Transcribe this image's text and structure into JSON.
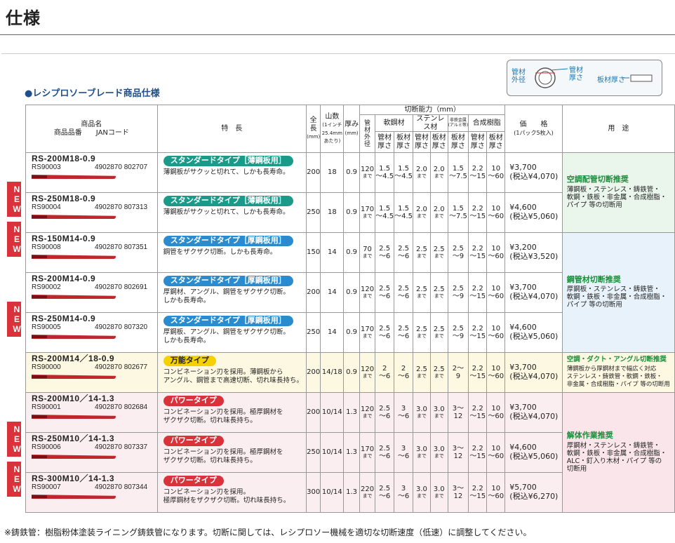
{
  "page": {
    "title": "仕様",
    "section_title": "●レシプロソーブレード商品仕様",
    "footnote": "※鋳鉄管：樹脂粉体塗装ライニング鋳鉄管になります。切断に関しては、レシプロソー機械を適切な切断速度（低速）に調整してください。",
    "new_label": "NEW"
  },
  "legend": {
    "pipe_outer": "管材\n外径",
    "pipe_thickness": "管材\n厚さ",
    "plate_thickness": "板材厚さ"
  },
  "header": {
    "product_name": "商品名",
    "product_code_jan": "商品品番　　JANコード",
    "features": "特　長",
    "length": "全長",
    "length_unit": "(mm)",
    "teeth": "山数",
    "teeth_unit": "(1インチ\n25.4mm\nあたり)",
    "thickness": "厚み",
    "thickness_unit": "(mm)",
    "cutting_capacity": "切断能力（mm）",
    "pipe_outer_dia": "管\n材\n外\n径",
    "mild_steel": "軟鋼材",
    "stainless": "ステンレス材",
    "nonferrous": "非鉄金属\n(アルミ等)",
    "synthetic_resin": "合成樹脂",
    "pipe_thick": "管材\n厚さ",
    "plate_thick": "板材\n厚さ",
    "price": "価　　格",
    "price_note": "(1パック5枚入)",
    "use": "用　途",
    "made_suffix": "まで"
  },
  "products": [
    {
      "model": "RS-200M18-0.9",
      "code": "RS90003",
      "jan": "4902870 802707",
      "badge": "スタンダードタイプ［薄鋼板用］",
      "desc": "薄鋼板がサクッと切れて、しかも長寿命。",
      "length": "200",
      "teeth": "18",
      "thick": "0.9",
      "dia": "120",
      "ms_pipe": "1.5\n～4.5",
      "ms_plate": "1.5\n～4.5",
      "ss_pipe": "2.0",
      "ss_plate": "2.0",
      "nf": "1.5\n～7.5",
      "res_pipe": "2.2\n～15",
      "res_plate": "10\n～60",
      "price": "¥3,700",
      "price_tax": "(税込¥4,070)",
      "new": false
    },
    {
      "model": "RS-250M18-0.9",
      "code": "RS90004",
      "jan": "4902870 807313",
      "badge": "スタンダードタイプ［薄鋼板用］",
      "desc": "薄鋼板がサクッと切れて、しかも長寿命。",
      "length": "250",
      "teeth": "18",
      "thick": "0.9",
      "dia": "170",
      "ms_pipe": "1.5\n～4.5",
      "ms_plate": "1.5\n～4.5",
      "ss_pipe": "2.0",
      "ss_plate": "2.0",
      "nf": "1.5\n～7.5",
      "res_pipe": "2.2\n～15",
      "res_plate": "10\n～60",
      "price": "¥4,600",
      "price_tax": "(税込¥5,060)",
      "new": true
    },
    {
      "model": "RS-150M14-0.9",
      "code": "RS90008",
      "jan": "4902870 807351",
      "badge": "スタンダードタイプ［厚鋼板用］",
      "desc": "鋼管をザクザク切断。しかも長寿命。",
      "length": "150",
      "teeth": "14",
      "thick": "0.9",
      "dia": "70",
      "ms_pipe": "2.5\n～6",
      "ms_plate": "2.5\n～6",
      "ss_pipe": "2.5",
      "ss_plate": "2.5",
      "nf": "2.5\n～9",
      "res_pipe": "2.2\n～15",
      "res_plate": "10\n～60",
      "price": "¥3,200",
      "price_tax": "(税込¥3,520)",
      "new": true
    },
    {
      "model": "RS-200M14-0.9",
      "code": "RS90002",
      "jan": "4902870 802691",
      "badge": "スタンダードタイプ［厚鋼板用］",
      "desc": "厚鋼材、アングル、鋼管をザクザク切断。\nしかも長寿命。",
      "length": "200",
      "teeth": "14",
      "thick": "0.9",
      "dia": "120",
      "ms_pipe": "2.5\n～6",
      "ms_plate": "2.5\n～6",
      "ss_pipe": "2.5",
      "ss_plate": "2.5",
      "nf": "2.5\n～9",
      "res_pipe": "2.2\n～15",
      "res_plate": "10\n～60",
      "price": "¥3,700",
      "price_tax": "(税込¥4,070)",
      "new": false
    },
    {
      "model": "RS-250M14-0.9",
      "code": "RS90005",
      "jan": "4902870 807320",
      "badge": "スタンダードタイプ［厚鋼板用］",
      "desc": "厚鋼板、アングル、鋼管をザクザク切断。\nしかも長寿命。",
      "length": "250",
      "teeth": "14",
      "thick": "0.9",
      "dia": "170",
      "ms_pipe": "2.5\n～6",
      "ms_plate": "2.5\n～6",
      "ss_pipe": "2.5",
      "ss_plate": "2.5",
      "nf": "2.5\n～9",
      "res_pipe": "2.2\n～15",
      "res_plate": "10\n～60",
      "price": "¥4,600",
      "price_tax": "(税込¥5,060)",
      "new": true
    },
    {
      "model": "RS-200M14／18-0.9",
      "code": "RS90000",
      "jan": "4902870 802677",
      "badge": "万能タイプ",
      "desc": "コンビネーション刃を採用。薄鋼板から\nアングル、鋼管まで高速切断、切れ味長持ち。",
      "length": "200",
      "teeth": "14/18",
      "thick": "0.9",
      "dia": "120",
      "ms_pipe": "2\n～6",
      "ms_plate": "2\n～6",
      "ss_pipe": "2.5",
      "ss_plate": "2.5",
      "nf": "2～\n9",
      "res_pipe": "2.2\n～15",
      "res_plate": "10\n～60",
      "price": "¥3,700",
      "price_tax": "(税込¥4,070)",
      "new": false
    },
    {
      "model": "RS-200M10／14-1.3",
      "code": "RS90001",
      "jan": "4902870 802684",
      "badge": "パワータイプ",
      "desc": "コンビネーション刃を採用。極厚鋼材を\nザクザク切断。切れ味長持ち。",
      "length": "200",
      "teeth": "10/14",
      "thick": "1.3",
      "dia": "120",
      "ms_pipe": "2.5\n～6",
      "ms_plate": "3\n～6",
      "ss_pipe": "3.0",
      "ss_plate": "3.0",
      "nf": "3～\n12",
      "res_pipe": "2.2\n～15",
      "res_plate": "10\n～60",
      "price": "¥3,700",
      "price_tax": "(税込¥4,070)",
      "new": false
    },
    {
      "model": "RS-250M10／14-1.3",
      "code": "RS90006",
      "jan": "4902870 807337",
      "badge": "パワータイプ",
      "desc": "コンビネーション刃を採用。極厚鋼材を\nザクザク切断。切れ味長持ち。",
      "length": "250",
      "teeth": "10/14",
      "thick": "1.3",
      "dia": "170",
      "ms_pipe": "2.5\n～6",
      "ms_plate": "3\n～6",
      "ss_pipe": "3.0",
      "ss_plate": "3.0",
      "nf": "3～\n12",
      "res_pipe": "2.2\n～15",
      "res_plate": "10\n～60",
      "price": "¥4,600",
      "price_tax": "(税込¥5,060)",
      "new": true
    },
    {
      "model": "RS-300M10／14-1.3",
      "code": "RS90007",
      "jan": "4902870 807344",
      "badge": "パワータイプ",
      "desc": "コンビネーション刃を採用。\n極厚鋼材をザクザク切断。切れ味長持ち。",
      "length": "300",
      "teeth": "10/14",
      "thick": "1.3",
      "dia": "220",
      "ms_pipe": "2.5\n～6",
      "ms_plate": "3\n～6",
      "ss_pipe": "3.0",
      "ss_plate": "3.0",
      "nf": "3～\n12",
      "res_pipe": "2.2\n～15",
      "res_plate": "10\n～60",
      "price": "¥5,700",
      "price_tax": "(税込¥6,270)",
      "new": true
    }
  ],
  "uses": [
    {
      "title": "空調配管切断推奨",
      "text": "薄鋼板・ステンレス・鋳鉄管・\n軟鋼・鉄板・非金属・合成樹脂・\nパイプ 等の切断用"
    },
    {
      "title": "鋼管材切断推奨",
      "text": "厚鋼板・ステンレス・鋳鉄管・\n軟鋼・鉄板・非金属・合成樹脂・\nパイプ 等の切断用"
    },
    {
      "title": "空調・ダクト・アングル切断推奨",
      "text": "薄鋼板から厚鋼材まで幅広く対応\nステンレス・鋳鉄管・軟鋼・鉄板・\n非金属・合成樹脂・パイプ 等の切断用"
    },
    {
      "title": "解体作業推奨",
      "text": "厚鋼材・ステンレス・鋳鉄管・\n軟鋼・鉄板・非金属・合成樹脂・\nALC・釘入り木材・パイプ 等の\n切断用"
    }
  ],
  "colors": {
    "teal": "#1a9b8a",
    "blue": "#2a8ccf",
    "yellow": "#f7d000",
    "red": "#d9323b",
    "new_badge": "#d9323b",
    "use_title": "#1a8e3a",
    "section_title": "#1f4f8a"
  }
}
